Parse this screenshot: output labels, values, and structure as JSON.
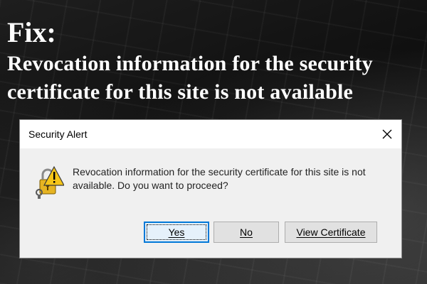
{
  "headline": {
    "fix": "Fix:",
    "line1": "Revocation information for the security",
    "line2": "certificate for this site is not available"
  },
  "dialog": {
    "title": "Security Alert",
    "close_icon": "close-icon",
    "warning_icon": "warning-lock-icon",
    "message_line1": "Revocation information for the security certificate for this site is not",
    "message_line2": "available. Do you want to proceed?",
    "buttons": {
      "yes": "Yes",
      "no": "No",
      "view_certificate": "View Certificate"
    }
  },
  "colors": {
    "focus_border": "#0078d7",
    "warning_yellow": "#f5c518",
    "dialog_bg": "#f0f0f0"
  }
}
